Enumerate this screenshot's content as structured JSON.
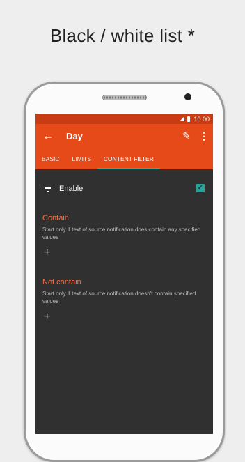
{
  "caption": "Black / white list *",
  "status_bar": {
    "time": "10:00"
  },
  "toolbar": {
    "title": "Day",
    "back_icon": "arrow-back-icon",
    "edit_icon": "pencil-icon",
    "more_icon": "more-vert-icon"
  },
  "tabs": [
    {
      "label": "BASIC"
    },
    {
      "label": "LIMITS"
    },
    {
      "label": "CONTENT FILTER",
      "active": true
    }
  ],
  "enable": {
    "label": "Enable",
    "checked": true
  },
  "contain": {
    "title": "Contain",
    "description": "Start only if text of source notification does contain any specified values"
  },
  "not_contain": {
    "title": "Not contain",
    "description": "Start only if text of source notification doesn't contain specified values"
  },
  "colors": {
    "primary": "#e64a19",
    "status_bar": "#c73c14",
    "accent": "#26a69a",
    "section_title": "#ff7043",
    "background": "#303030"
  }
}
